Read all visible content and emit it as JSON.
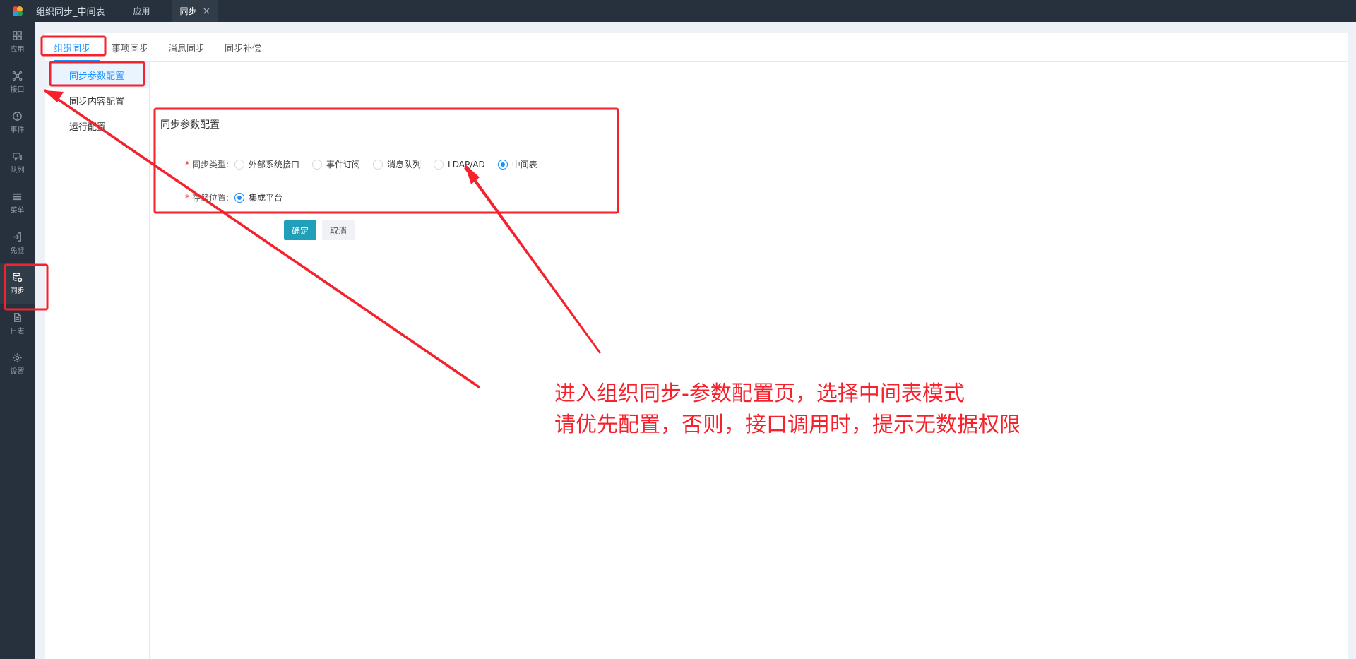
{
  "topbar": {
    "app_name": "组织同步_中间表",
    "tabs": [
      {
        "label": "应用"
      },
      {
        "label": "同步"
      }
    ]
  },
  "rail": {
    "items": [
      {
        "label": "应用",
        "icon": "grid-icon"
      },
      {
        "label": "接口",
        "icon": "network-icon"
      },
      {
        "label": "事件",
        "icon": "alert-circle-icon"
      },
      {
        "label": "队列",
        "icon": "message-queue-icon"
      },
      {
        "label": "菜单",
        "icon": "menu-icon"
      },
      {
        "label": "免登",
        "icon": "login-icon"
      },
      {
        "label": "同步",
        "icon": "database-sync-icon"
      },
      {
        "label": "日志",
        "icon": "document-icon"
      },
      {
        "label": "设置",
        "icon": "gear-icon"
      }
    ],
    "active": "同步"
  },
  "tabs": [
    {
      "label": "组织同步"
    },
    {
      "label": "事项同步"
    },
    {
      "label": "消息同步"
    },
    {
      "label": "同步补偿"
    }
  ],
  "subnav": [
    {
      "label": "同步参数配置"
    },
    {
      "label": "同步内容配置"
    },
    {
      "label": "运行配置"
    }
  ],
  "section_title": "同步参数配置",
  "form": {
    "sync_type": {
      "label": "同步类型:",
      "options": [
        "外部系统接口",
        "事件订阅",
        "消息队列",
        "LDAP/AD",
        "中间表"
      ],
      "selected": "中间表"
    },
    "storage": {
      "label": "存储位置:",
      "options": [
        "集成平台"
      ],
      "selected": "集成平台"
    },
    "ok_label": "确定",
    "cancel_label": "取消"
  },
  "annotation": {
    "line1": "进入组织同步-参数配置页，选择中间表模式",
    "line2": "请优先配置，否则，接口调用时，提示无数据权限",
    "color": "#f5222d"
  },
  "colors": {
    "rail_bg": "#27313d",
    "accent": "#1890ff",
    "primary_button": "#1fa0b8"
  }
}
